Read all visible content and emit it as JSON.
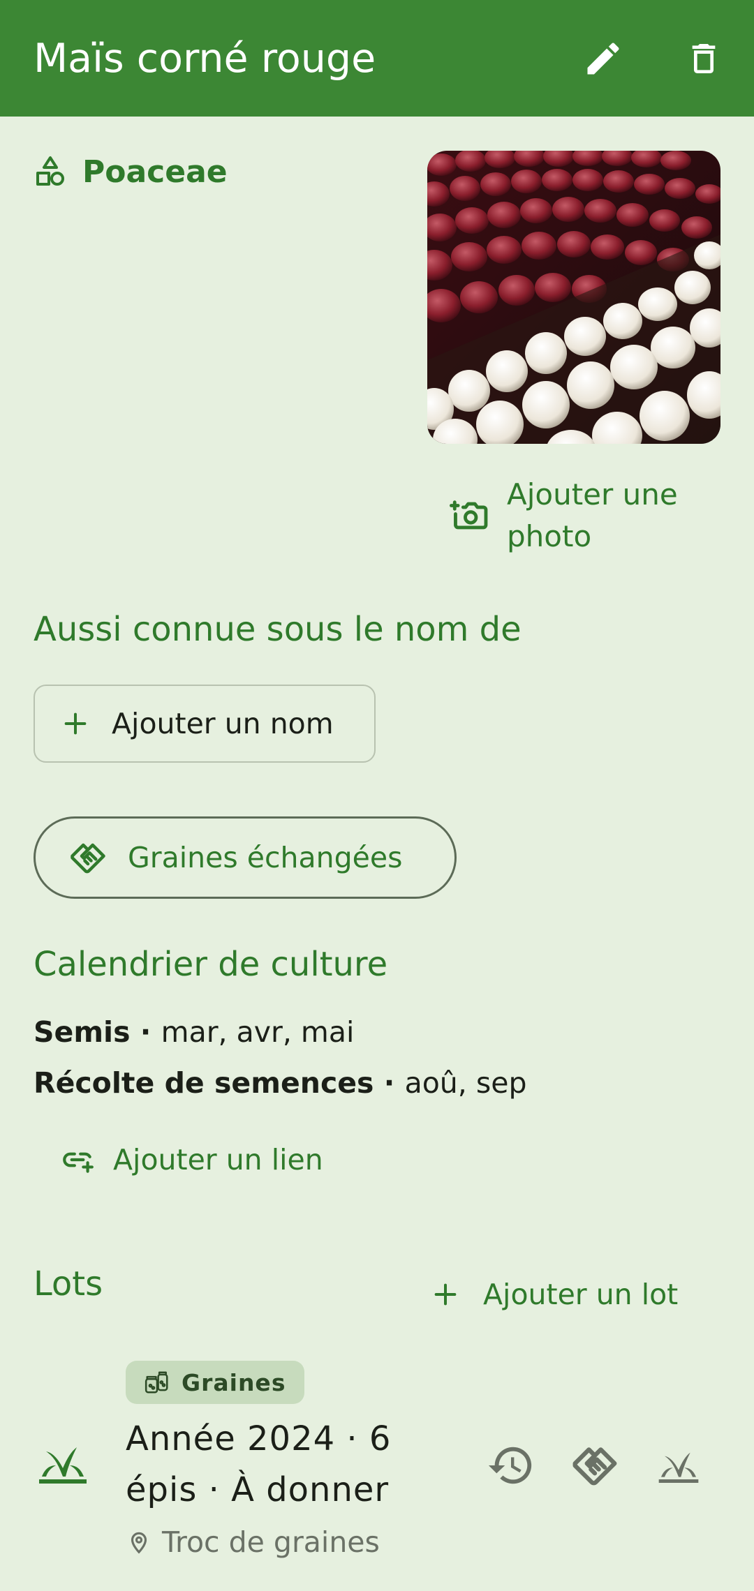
{
  "app_bar": {
    "title": "Maïs corné rouge",
    "actions": [
      "pencil-icon",
      "trash-icon"
    ]
  },
  "family": {
    "icon": "shapes-icon",
    "name": "Poaceae"
  },
  "photo": {
    "add_label": "Ajouter une photo",
    "icon": "camera-plus-icon"
  },
  "aliases": {
    "heading": "Aussi connue sous le nom de",
    "add_label": "Ajouter un nom"
  },
  "exchange_chip": {
    "label": "Graines échangées",
    "icon": "handshake-icon"
  },
  "calendar": {
    "heading": "Calendrier de culture",
    "rows": [
      {
        "label": "Semis",
        "sep": " · ",
        "months": "mar, avr, mai"
      },
      {
        "label": "Récolte de semences",
        "sep": " · ",
        "months": "aoû, sep"
      }
    ]
  },
  "link": {
    "add_label": "Ajouter un lien",
    "icon": "link-plus-icon"
  },
  "lots": {
    "heading": "Lots",
    "add_label": "Ajouter un lot",
    "items": [
      {
        "badge": "Graines",
        "description": "Année 2024 · 6 épis · À donner",
        "location": "Troc de graines",
        "actions": [
          "history-icon",
          "handshake-icon",
          "sprout-icon"
        ]
      }
    ]
  },
  "colors": {
    "primary": "#3c8734",
    "accent_text": "#2f7a2b",
    "background": "#e6f0df"
  }
}
